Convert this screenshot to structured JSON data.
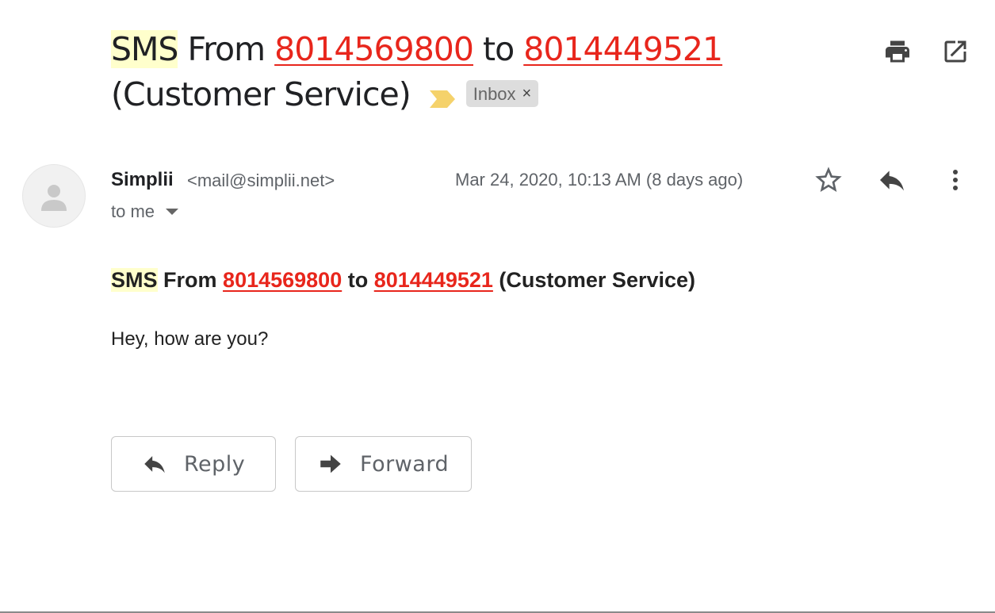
{
  "subject": {
    "prefix": "SMS",
    "from_word": "From",
    "from_number": "8014569800",
    "to_word": "to",
    "to_number": "8014449521",
    "suffix": "(Customer Service)"
  },
  "label_chip": {
    "text": "Inbox",
    "remove_glyph": "×"
  },
  "toolbar": {
    "print_icon": "print-icon",
    "open_new_window_icon": "open-in-new-window-icon"
  },
  "message": {
    "sender_name": "Simplii",
    "sender_email": "<mail@simplii.net>",
    "recipient": "to me",
    "date": "Mar 24, 2020, 10:13 AM (8 days ago)",
    "icons": [
      "star-icon",
      "reply-icon",
      "more-vert-icon"
    ],
    "body_title": {
      "prefix": "SMS",
      "from_word": "From",
      "from_number": "8014569800",
      "to_word": "to",
      "to_number": "8014449521",
      "suffix": "(Customer Service)"
    },
    "body_text": "Hey, how are you?"
  },
  "actions": {
    "reply_label": "Reply",
    "forward_label": "Forward"
  },
  "colors": {
    "highlight": "#ffffcc",
    "link": "#e8261c",
    "importance_marker": "#f5d26b",
    "chip_bg": "#dddddd"
  }
}
